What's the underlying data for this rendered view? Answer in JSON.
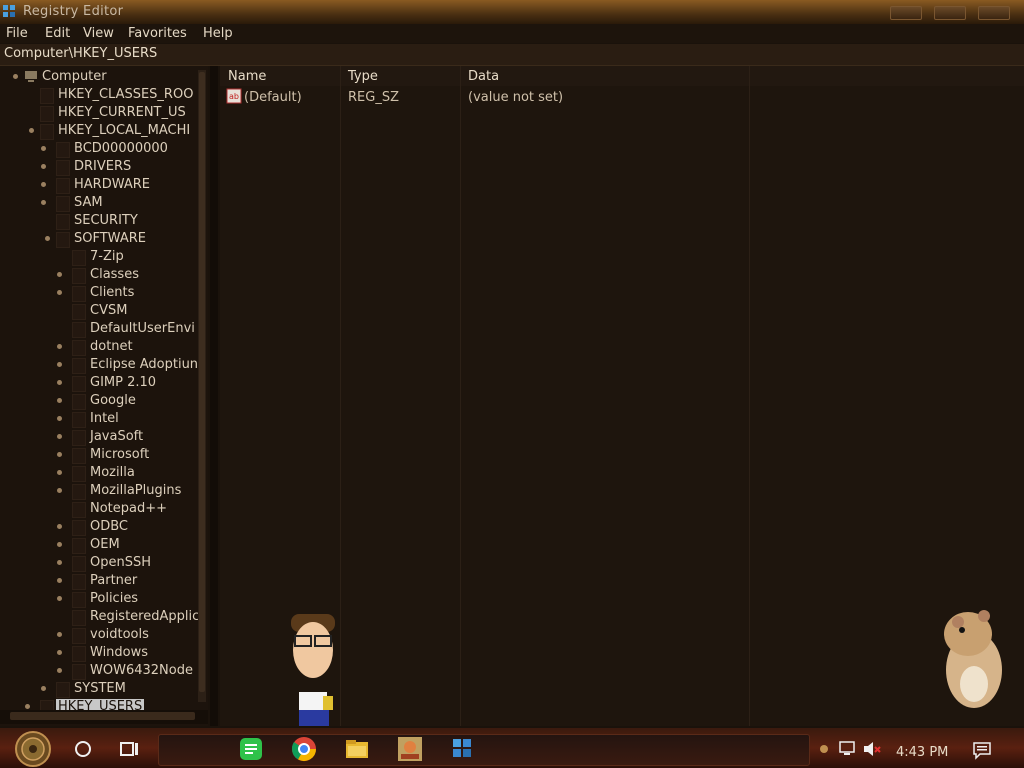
{
  "window": {
    "title": "Registry Editor",
    "icon": "registry-icon"
  },
  "menu": [
    {
      "label": "File"
    },
    {
      "label": "Edit"
    },
    {
      "label": "View"
    },
    {
      "label": "Favorites"
    },
    {
      "label": "Help"
    }
  ],
  "address": "Computer\\HKEY_USERS",
  "tree": [
    {
      "label": "Computer",
      "icon": "computer-icon"
    },
    {
      "label": "HKEY_CLASSES_ROO"
    },
    {
      "label": "HKEY_CURRENT_US"
    },
    {
      "label": "HKEY_LOCAL_MACHI"
    },
    {
      "label": "BCD00000000"
    },
    {
      "label": "DRIVERS"
    },
    {
      "label": "HARDWARE"
    },
    {
      "label": "SAM"
    },
    {
      "label": "SECURITY"
    },
    {
      "label": "SOFTWARE"
    },
    {
      "label": "7-Zip"
    },
    {
      "label": "Classes"
    },
    {
      "label": "Clients"
    },
    {
      "label": "CVSM"
    },
    {
      "label": "DefaultUserEnvi"
    },
    {
      "label": "dotnet"
    },
    {
      "label": "Eclipse Adoptiun"
    },
    {
      "label": "GIMP 2.10"
    },
    {
      "label": "Google"
    },
    {
      "label": "Intel"
    },
    {
      "label": "JavaSoft"
    },
    {
      "label": "Microsoft"
    },
    {
      "label": "Mozilla"
    },
    {
      "label": "MozillaPlugins"
    },
    {
      "label": "Notepad++"
    },
    {
      "label": "ODBC"
    },
    {
      "label": "OEM"
    },
    {
      "label": "OpenSSH"
    },
    {
      "label": "Partner"
    },
    {
      "label": "Policies"
    },
    {
      "label": "RegisteredApplic"
    },
    {
      "label": "voidtools"
    },
    {
      "label": "Windows"
    },
    {
      "label": "WOW6432Node"
    },
    {
      "label": "SYSTEM"
    },
    {
      "label": "HKEY_USERS"
    }
  ],
  "list": {
    "columns": [
      "Name",
      "Type",
      "Data"
    ],
    "rows": [
      {
        "name": "(Default)",
        "type": "REG_SZ",
        "data": "(value not set)",
        "icon": "string-value-icon"
      }
    ]
  },
  "taskbar": {
    "clock": "4:43 PM",
    "apps": [
      "search-icon",
      "task-view-icon",
      "notes-app-icon",
      "chrome-icon",
      "file-explorer-icon",
      "game-app-icon",
      "registry-editor-icon"
    ]
  },
  "colors": {
    "accent": "#8a5a22",
    "background": "#1e150d",
    "text": "#ddd0bc"
  }
}
